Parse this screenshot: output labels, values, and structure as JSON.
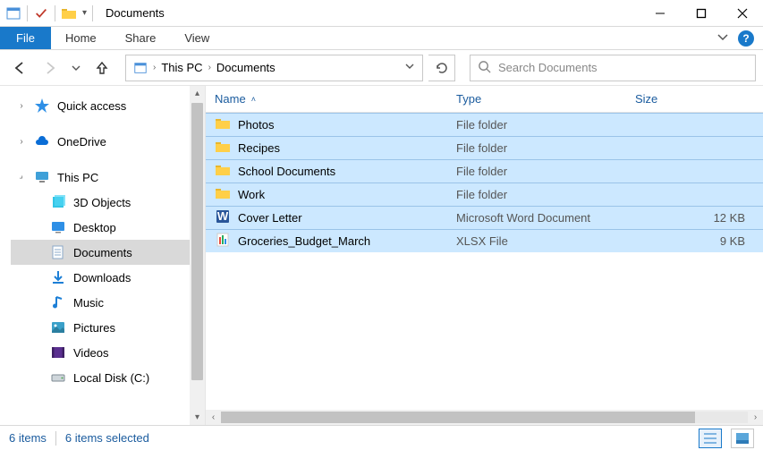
{
  "window": {
    "title": "Documents"
  },
  "ribbon": {
    "file": "File",
    "tabs": [
      "Home",
      "Share",
      "View"
    ]
  },
  "breadcrumbs": {
    "items": [
      "This PC",
      "Documents"
    ]
  },
  "search": {
    "placeholder": "Search Documents"
  },
  "sidebar": {
    "quickAccess": "Quick access",
    "oneDrive": "OneDrive",
    "thisPC": "This PC",
    "children": [
      {
        "label": "3D Objects",
        "iconColor": "#33b5e5"
      },
      {
        "label": "Desktop",
        "iconColor": "#2e8fe6"
      },
      {
        "label": "Documents",
        "iconColor": "#8aa8c8"
      },
      {
        "label": "Downloads",
        "iconColor": "#1d7fd6"
      },
      {
        "label": "Music",
        "iconColor": "#1d7fd6"
      },
      {
        "label": "Pictures",
        "iconColor": "#3aa0c9"
      },
      {
        "label": "Videos",
        "iconColor": "#5a2f8f"
      },
      {
        "label": "Local Disk (C:)",
        "iconColor": "#9aa7b0"
      }
    ],
    "activeIndex": 2
  },
  "columns": {
    "name": "Name",
    "type": "Type",
    "size": "Size",
    "sortColumn": "name",
    "sortDir": "asc"
  },
  "items": [
    {
      "name": "Photos",
      "type": "File folder",
      "size": "",
      "icon": "folder"
    },
    {
      "name": "Recipes",
      "type": "File folder",
      "size": "",
      "icon": "folder"
    },
    {
      "name": "School Documents",
      "type": "File folder",
      "size": "",
      "icon": "folder"
    },
    {
      "name": "Work",
      "type": "File folder",
      "size": "",
      "icon": "folder"
    },
    {
      "name": "Cover Letter",
      "type": "Microsoft Word Document",
      "size": "12 KB",
      "icon": "word"
    },
    {
      "name": "Groceries_Budget_March",
      "type": "XLSX File",
      "size": "9 KB",
      "icon": "xlsx"
    }
  ],
  "status": {
    "count": "6 items",
    "selected": "6 items selected"
  }
}
